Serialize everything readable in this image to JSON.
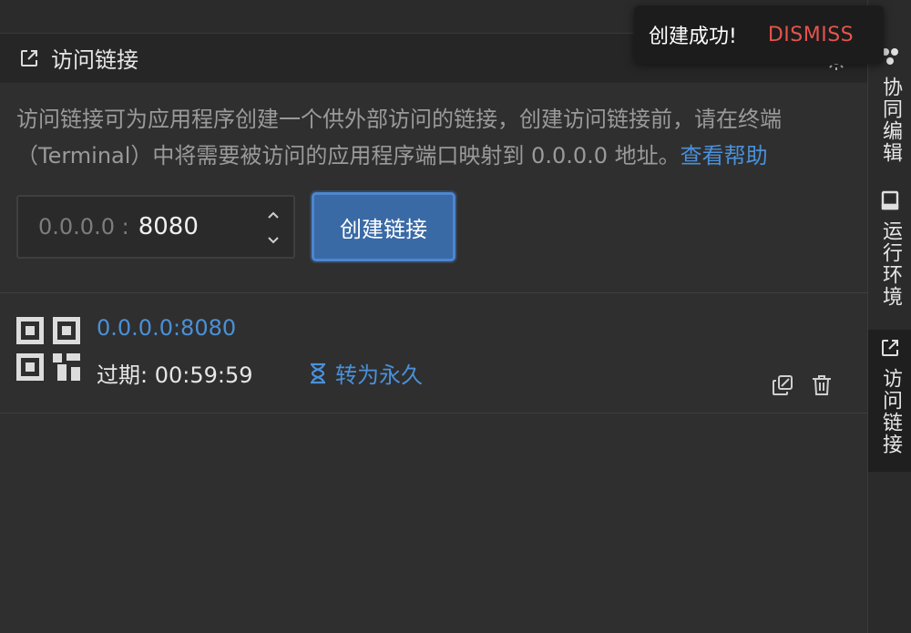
{
  "panel": {
    "title": "访问链接",
    "description": "访问链接可为应用程序创建一个供外部访问的链接，创建访问链接前，请在终端（Terminal）中将需要被访问的应用程序端口映射到 0.0.0.0 地址。",
    "help_link": "查看帮助",
    "icons": {
      "header": "external-link-icon",
      "settings": "gear-icon"
    }
  },
  "port_input": {
    "prefix": "0.0.0.0 :",
    "value": "8080"
  },
  "create_button": {
    "label": "创建链接"
  },
  "links": [
    {
      "url": "0.0.0.0:8080",
      "expire_label": "过期: 00:59:59",
      "permanent_label": "转为永久"
    }
  ],
  "sidebar": {
    "tabs": [
      {
        "label": "协同编辑",
        "icon": "collaboration-icon",
        "active": false
      },
      {
        "label": "运行环境",
        "icon": "runtime-icon",
        "active": false
      },
      {
        "label": "访问链接",
        "icon": "external-link-icon",
        "active": true
      }
    ]
  },
  "toast": {
    "message": "创建成功!",
    "dismiss": "DISMISS"
  },
  "colors": {
    "accent": "#4a90d9",
    "button": "#3a6aa6",
    "danger": "#e5544c",
    "background": "#2f2f2f"
  }
}
